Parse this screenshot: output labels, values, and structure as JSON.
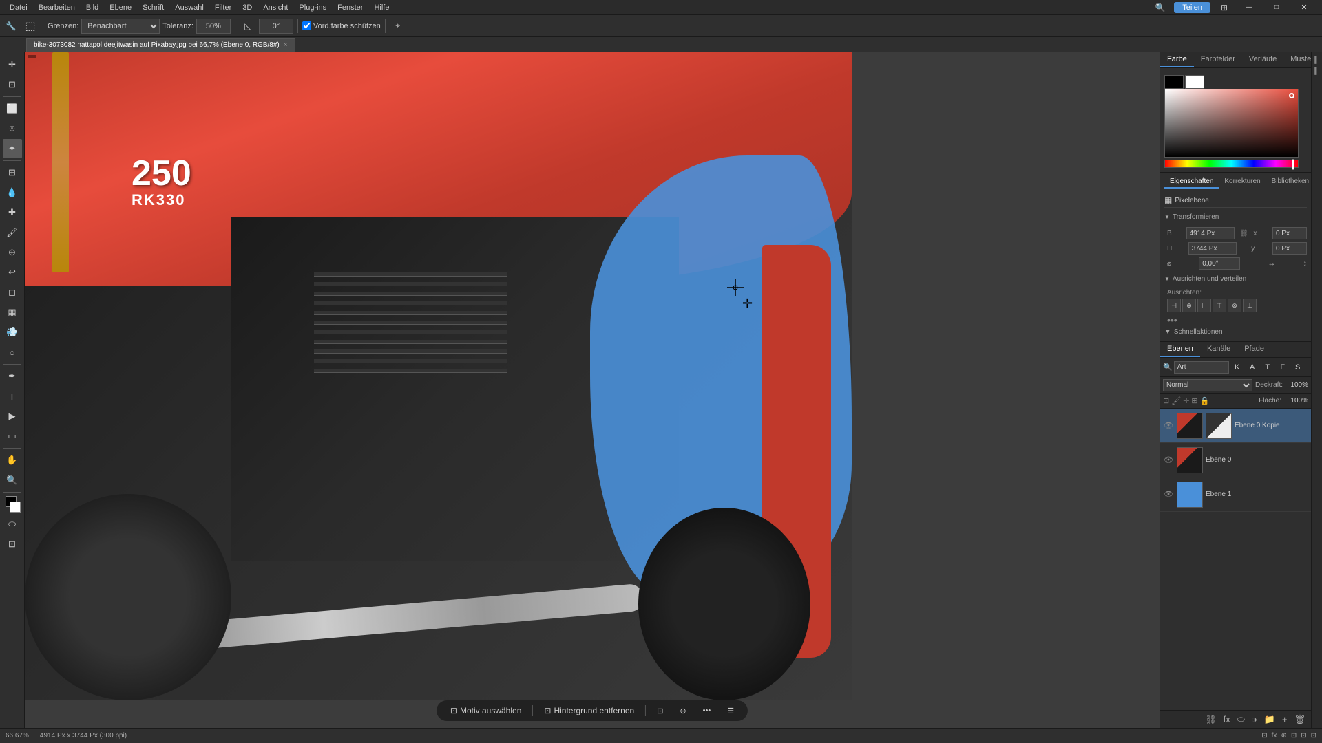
{
  "menubar": {
    "items": [
      "Datei",
      "Bearbeiten",
      "Bild",
      "Ebene",
      "Schrift",
      "Auswahl",
      "Filter",
      "3D",
      "Ansicht",
      "Plug-ins",
      "Fenster",
      "Hilfe"
    ]
  },
  "toolbar": {
    "grenzen_label": "Grenzen:",
    "grenzen_value": "Benachbart",
    "toleranz_label": "Toleranz:",
    "toleranz_value": "50%",
    "angle_value": "0°",
    "vordfarbe_label": "Vord.farbe schützen"
  },
  "tab": {
    "title": "bike-3073082 nattapol deejitwasin auf Pixabay.jpg bei 66,7% (Ebene 0, RGB/8#)",
    "close": "×"
  },
  "canvas": {
    "zoom": "66,67%",
    "dimensions": "4914 Px x 3744 Px (300 ppi)"
  },
  "right_panel": {
    "tabs": {
      "farbe": "Farbe",
      "farbfelder": "Farbfelder",
      "verläufe": "Verläufe",
      "muster": "Muster"
    },
    "properties_tabs": {
      "eigenschaften": "Eigenschaften",
      "korrekturen": "Korrekturen",
      "bibliotheken": "Bibliotheken"
    },
    "pixel_label": "Pixelebene",
    "transformieren": {
      "label": "Transformieren",
      "b_label": "B",
      "b_value": "4914 Px",
      "h_label": "H",
      "h_value": "3744 Px",
      "x_label": "x",
      "x_value": "0 Px",
      "y_label": "y",
      "y_value": "0 Px",
      "angle_value": "0,00°"
    },
    "ausrichten": {
      "label": "Ausrichten und verteilen",
      "sub_label": "Ausrichten:"
    },
    "schnellaktionen": {
      "label": "Schnellaktionen"
    }
  },
  "layers_panel": {
    "tabs": [
      "Ebenen",
      "Kanäle",
      "Pfade"
    ],
    "search_placeholder": "Art",
    "mode": "Normal",
    "deckraft_label": "Deckraft:",
    "deckraft_value": "100%",
    "fläche_label": "Fläche:",
    "fläche_value": "100%",
    "layers": [
      {
        "name": "Ebene 0 Kopie",
        "visible": true,
        "has_mask": true
      },
      {
        "name": "Ebene 0",
        "visible": true,
        "has_mask": false
      },
      {
        "name": "Ebene 1",
        "visible": true,
        "has_mask": false,
        "color": "#4a90d9"
      }
    ]
  },
  "bottom_toolbar": {
    "motiv_label": "Motiv auswählen",
    "hintergrund_label": "Hintergrund entfernen"
  },
  "status_bar": {
    "zoom": "66,67%",
    "dimensions": "4914 Px x 3744 Px (300 ppi)"
  },
  "header_right_icons": {
    "share_btn": "Teilen"
  }
}
